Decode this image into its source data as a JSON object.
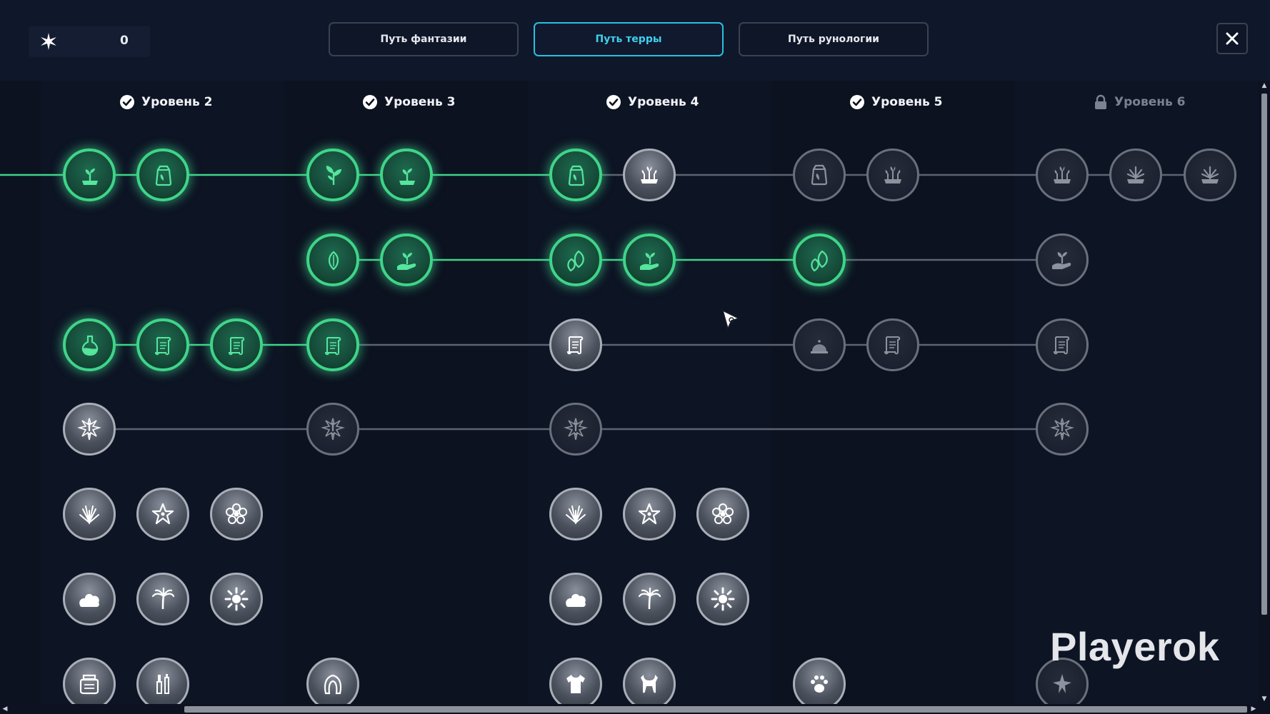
{
  "header": {
    "points_value": "0",
    "tabs": [
      {
        "label": "Путь фантазии",
        "active": false
      },
      {
        "label": "Путь терры",
        "active": true
      },
      {
        "label": "Путь рунологии",
        "active": false
      }
    ]
  },
  "levels": [
    {
      "label": "Уровень 2",
      "state": "complete"
    },
    {
      "label": "Уровень 3",
      "state": "complete"
    },
    {
      "label": "Уровень 4",
      "state": "complete"
    },
    {
      "label": "Уровень 5",
      "state": "complete"
    },
    {
      "label": "Уровень 6",
      "state": "locked"
    }
  ],
  "colors": {
    "accent": "#29c0e0",
    "done": "#3fd589",
    "line_done": "#3fd589",
    "line_locked": "#5d6370"
  },
  "skill_rows": [
    {
      "nodes": [
        {
          "id": "r1-a",
          "state": "done",
          "icon": "sprout-in-pot-icon"
        },
        {
          "id": "r1-b",
          "state": "done",
          "icon": "seed-bag-icon"
        },
        {
          "id": "r1-c",
          "state": "done",
          "icon": "leafy-sprout-icon"
        },
        {
          "id": "r1-d",
          "state": "done",
          "icon": "sprout-in-pot-icon"
        },
        {
          "id": "r1-e",
          "state": "done",
          "icon": "seed-bag-icon"
        },
        {
          "id": "r1-f",
          "state": "avail",
          "icon": "planter-sprouts-icon"
        },
        {
          "id": "r1-g",
          "state": "lock",
          "icon": "seed-bag-icon"
        },
        {
          "id": "r1-h",
          "state": "lock",
          "icon": "planter-sprouts-icon"
        },
        {
          "id": "r1-i",
          "state": "lock",
          "icon": "planter-sprouts-icon"
        },
        {
          "id": "r1-j",
          "state": "lock",
          "icon": "planter-spiky-icon"
        },
        {
          "id": "r1-k",
          "state": "lock",
          "icon": "planter-spiky-icon"
        }
      ]
    },
    {
      "nodes": [
        {
          "id": "r2-a",
          "state": "done",
          "icon": "leaf-icon"
        },
        {
          "id": "r2-b",
          "state": "done",
          "icon": "hand-sprout-icon"
        },
        {
          "id": "r2-c",
          "state": "done",
          "icon": "double-leaf-icon"
        },
        {
          "id": "r2-d",
          "state": "done",
          "icon": "hand-sprout-icon"
        },
        {
          "id": "r2-e",
          "state": "done",
          "icon": "double-leaf-icon"
        },
        {
          "id": "r2-f",
          "state": "lock",
          "icon": "hand-sprout-icon"
        }
      ]
    },
    {
      "nodes": [
        {
          "id": "r3-a",
          "state": "done",
          "icon": "potion-icon"
        },
        {
          "id": "r3-b",
          "state": "done",
          "icon": "scroll-icon"
        },
        {
          "id": "r3-c",
          "state": "done",
          "icon": "scroll-icon"
        },
        {
          "id": "r3-d",
          "state": "done",
          "icon": "scroll-icon"
        },
        {
          "id": "r3-e",
          "state": "avail",
          "icon": "scroll-icon"
        },
        {
          "id": "r3-f",
          "state": "lock",
          "icon": "dome-icon"
        },
        {
          "id": "r3-g",
          "state": "lock",
          "icon": "scroll-icon"
        },
        {
          "id": "r3-h",
          "state": "lock",
          "icon": "scroll-icon"
        }
      ]
    },
    {
      "nodes": [
        {
          "id": "r4-a",
          "state": "avail",
          "icon": "alert-burst-icon"
        },
        {
          "id": "r4-b",
          "state": "lock",
          "icon": "alert-burst-icon"
        },
        {
          "id": "r4-c",
          "state": "lock",
          "icon": "alert-burst-icon"
        },
        {
          "id": "r4-d",
          "state": "lock",
          "icon": "alert-burst-icon"
        }
      ]
    },
    {
      "nodes": [
        {
          "id": "r5-a",
          "state": "avail",
          "icon": "spiky-plant-icon"
        },
        {
          "id": "r5-b",
          "state": "avail",
          "icon": "star-flower-icon"
        },
        {
          "id": "r5-c",
          "state": "avail",
          "icon": "flower-icon"
        },
        {
          "id": "r5-d",
          "state": "avail",
          "icon": "spiky-plant-icon"
        },
        {
          "id": "r5-e",
          "state": "avail",
          "icon": "star-flower-icon"
        },
        {
          "id": "r5-f",
          "state": "avail",
          "icon": "flower-icon"
        }
      ]
    },
    {
      "nodes": [
        {
          "id": "r6-a",
          "state": "avail",
          "icon": "bush-icon"
        },
        {
          "id": "r6-b",
          "state": "avail",
          "icon": "palm-icon"
        },
        {
          "id": "r6-c",
          "state": "avail",
          "icon": "sunflower-icon"
        },
        {
          "id": "r6-d",
          "state": "avail",
          "icon": "bush-icon"
        },
        {
          "id": "r6-e",
          "state": "avail",
          "icon": "palm-icon"
        },
        {
          "id": "r6-f",
          "state": "avail",
          "icon": "sunflower-icon"
        }
      ]
    },
    {
      "nodes": [
        {
          "id": "r7-a",
          "state": "avail",
          "icon": "jar-icon"
        },
        {
          "id": "r7-b",
          "state": "avail",
          "icon": "cosmetics-icon"
        },
        {
          "id": "r7-c",
          "state": "avail",
          "icon": "hair-icon"
        },
        {
          "id": "r7-d",
          "state": "avail",
          "icon": "shirt-icon"
        },
        {
          "id": "r7-e",
          "state": "avail",
          "icon": "bib-icon"
        },
        {
          "id": "r7-f",
          "state": "avail",
          "icon": "paw-icon"
        },
        {
          "id": "r7-g",
          "state": "lock",
          "icon": "star-badge-icon"
        }
      ]
    }
  ],
  "watermark": "Playerok"
}
